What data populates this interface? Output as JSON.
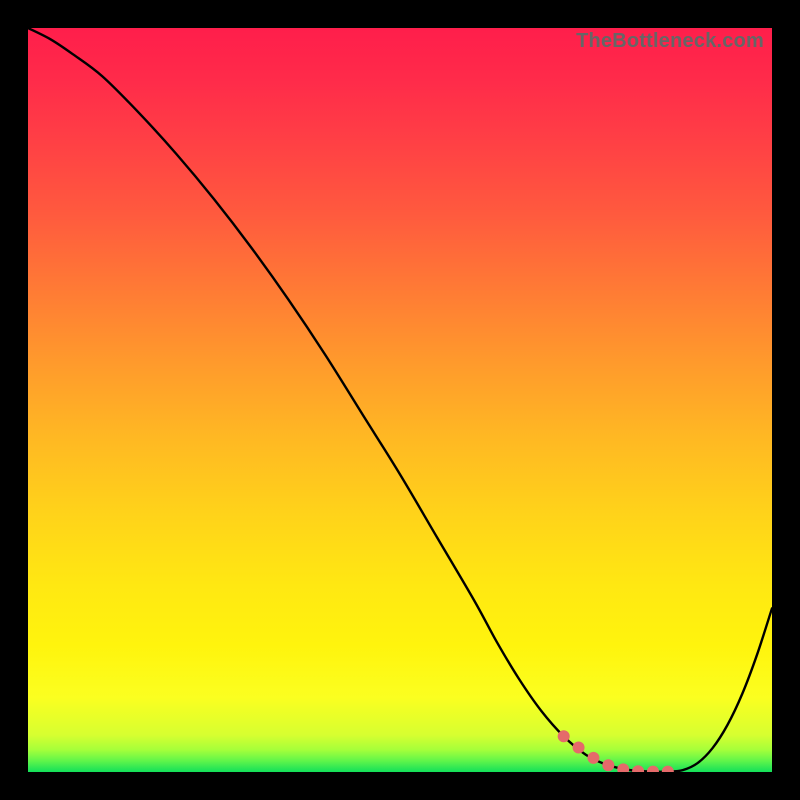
{
  "watermark": "TheBottleneck.com",
  "chart_data": {
    "type": "line",
    "title": "",
    "xlabel": "",
    "ylabel": "",
    "xlim": [
      0,
      100
    ],
    "ylim": [
      0,
      100
    ],
    "gradient_stops": [
      {
        "offset": 0,
        "color": "#ff1e4b"
      },
      {
        "offset": 7,
        "color": "#ff2b4a"
      },
      {
        "offset": 15,
        "color": "#ff3f45"
      },
      {
        "offset": 25,
        "color": "#ff5a3e"
      },
      {
        "offset": 35,
        "color": "#ff7a35"
      },
      {
        "offset": 45,
        "color": "#ff9a2c"
      },
      {
        "offset": 55,
        "color": "#ffb823"
      },
      {
        "offset": 65,
        "color": "#ffd21a"
      },
      {
        "offset": 75,
        "color": "#ffe812"
      },
      {
        "offset": 83,
        "color": "#fff40d"
      },
      {
        "offset": 90,
        "color": "#fbff20"
      },
      {
        "offset": 95,
        "color": "#d7ff30"
      },
      {
        "offset": 97,
        "color": "#a6ff3a"
      },
      {
        "offset": 98.5,
        "color": "#60f54a"
      },
      {
        "offset": 100,
        "color": "#12e05a"
      }
    ],
    "series": [
      {
        "name": "bottleneck-curve",
        "x": [
          0,
          3,
          6,
          10,
          15,
          20,
          25,
          30,
          35,
          40,
          45,
          50,
          55,
          60,
          63,
          66,
          69,
          72,
          75,
          78,
          81,
          84,
          86,
          88,
          90,
          92,
          94,
          96,
          98,
          100
        ],
        "values": [
          100,
          98.5,
          96.5,
          93.5,
          88.5,
          83,
          77,
          70.5,
          63.5,
          56,
          48,
          40,
          31.5,
          23,
          17.5,
          12.5,
          8.2,
          4.8,
          2.3,
          0.9,
          0.25,
          0.05,
          0.05,
          0.25,
          1.2,
          3.2,
          6.3,
          10.5,
          15.8,
          22.0
        ]
      }
    ],
    "optimal_markers": {
      "name": "optimal-zone",
      "color": "#e56a6a",
      "x": [
        72,
        74,
        76,
        78,
        80,
        82,
        84,
        86
      ],
      "values": [
        4.8,
        3.3,
        1.9,
        0.9,
        0.35,
        0.1,
        0.05,
        0.05
      ]
    }
  }
}
